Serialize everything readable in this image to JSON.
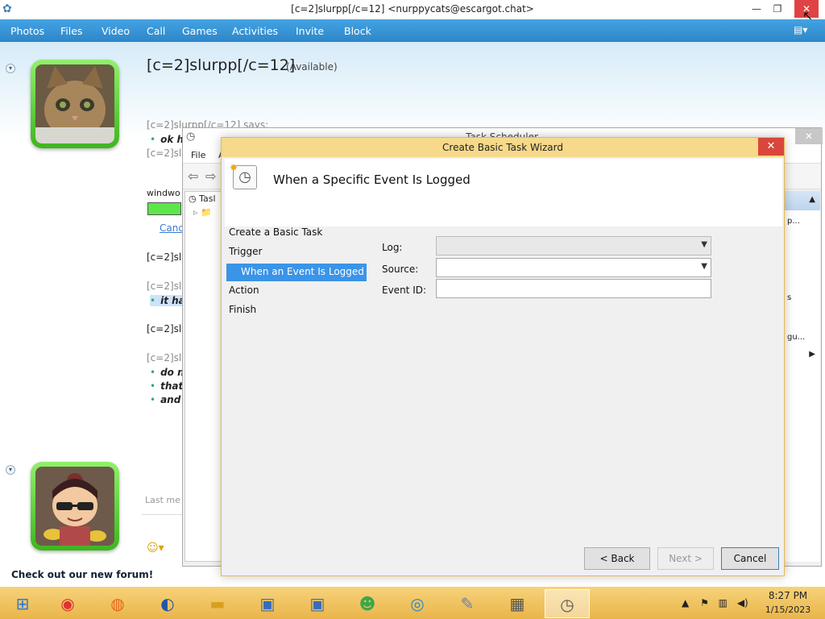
{
  "messenger": {
    "window_title": "[c=2]slurpp[/c=12] <nurppycats@escargot.chat>",
    "window_controls": {
      "minimize": "—",
      "maximize": "❐",
      "close": "✕"
    },
    "menu": [
      "Photos",
      "Files",
      "Video",
      "Call",
      "Games",
      "Activities",
      "Invite",
      "Block"
    ],
    "contact": {
      "name": "[c=2]slurpp[/c=12]",
      "status": "(Available)"
    },
    "chat": {
      "says_header": "[c=2]slurpp[/c=12] says:",
      "lines": [
        {
          "type": "bullet",
          "text": "ok h"
        },
        {
          "type": "name",
          "text": "[c=2]sl"
        },
        {
          "type": "plain",
          "text": "windwo"
        },
        {
          "type": "link",
          "text": "Canc"
        },
        {
          "type": "name",
          "text": "[c=2]sl"
        },
        {
          "type": "name",
          "text": "[c=2]sl"
        },
        {
          "type": "bullet_selected",
          "text": "it ha"
        },
        {
          "type": "name",
          "text": "[c=2]sl"
        },
        {
          "type": "name",
          "text": "[c=2]sl"
        },
        {
          "type": "bullet",
          "text": "do n"
        },
        {
          "type": "bullet",
          "text": "that"
        },
        {
          "type": "bullet",
          "text": "and"
        }
      ],
      "last_message": "Last me"
    },
    "forum_link": "Check out our new forum!"
  },
  "task_scheduler": {
    "title": "Task Scheduler",
    "menu": [
      "File",
      "A"
    ],
    "tree_root": "Tasl",
    "actions_snippets": [
      "p...",
      "s",
      "gu..."
    ]
  },
  "wizard": {
    "title": "Create Basic Task Wizard",
    "heading": "When a Specific Event Is Logged",
    "steps": [
      {
        "label": "Create a Basic Task",
        "selected": false
      },
      {
        "label": "Trigger",
        "selected": false
      },
      {
        "label": "When an Event Is Logged",
        "selected": true
      },
      {
        "label": "Action",
        "selected": false
      },
      {
        "label": "Finish",
        "selected": false
      }
    ],
    "fields": {
      "log_label": "Log:",
      "log_value": "",
      "source_label": "Source:",
      "source_value": "",
      "event_id_label": "Event ID:",
      "event_id_value": ""
    },
    "buttons": {
      "back": "< Back",
      "next": "Next >",
      "cancel": "Cancel"
    }
  },
  "taskbar": {
    "apps": [
      "start-icon",
      "chrome-icon",
      "firefox-icon",
      "obama-icon",
      "folder-icon",
      "network-computer-icon",
      "remote-desktop-icon",
      "messenger-contacts-icon",
      "edge-icon",
      "paint-icon",
      "calendar-icon",
      "clock-icon"
    ],
    "time": "8:27 PM",
    "date": "1/15/2023"
  }
}
